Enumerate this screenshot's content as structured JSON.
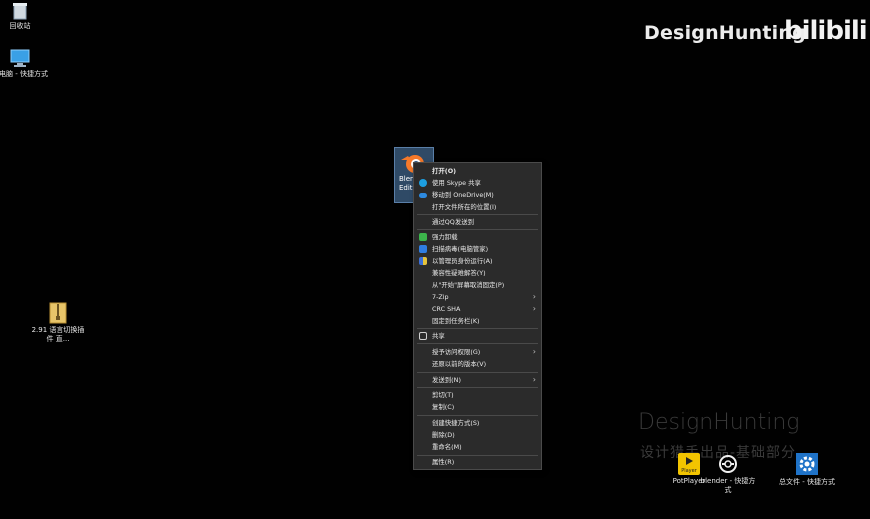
{
  "brand": {
    "name": "DesignHunting",
    "platform": "bilibili"
  },
  "watermark": {
    "en": "DesignHunting",
    "zh": "设计猎手出品-基础部分"
  },
  "desktop": {
    "icons": [
      {
        "label": "回收站",
        "icon": "recycle-bin-icon"
      },
      {
        "label": "此电脑 - 快捷方式",
        "icon": "computer-icon"
      },
      {
        "label": "2.91 语言切换插件 直...",
        "icon": "zip-folder-icon"
      },
      {
        "label": "PotPlayer",
        "icon": "potplayer-icon",
        "badge": "Player"
      },
      {
        "label": "blender - 快捷方式",
        "icon": "blender-shortcut-icon"
      },
      {
        "label": "总文件 - 快捷方式",
        "icon": "gear-icon"
      }
    ],
    "selected_icon_label": "Blen Oct Edit"
  },
  "context_menu": {
    "items": [
      {
        "label": "打开(O)",
        "bold": true
      },
      {
        "label": "使用 Skype 共享",
        "icon": "skype-icon"
      },
      {
        "label": "移动到 OneDrive(M)",
        "icon": "onedrive-icon"
      },
      {
        "label": "打开文件所在的位置(I)"
      },
      {
        "sep": true
      },
      {
        "label": "通过QQ发送到"
      },
      {
        "sep": true
      },
      {
        "label": "强力卸载",
        "icon": "uninstall-icon"
      },
      {
        "label": "扫描病毒(电脑管家)",
        "icon": "shield-scan-icon"
      },
      {
        "label": "以管理员身份运行(A)",
        "icon": "admin-shield-icon"
      },
      {
        "label": "兼容性疑难解答(Y)"
      },
      {
        "label": "从\"开始\"屏幕取消固定(P)"
      },
      {
        "label": "7-Zip",
        "submenu": true
      },
      {
        "label": "CRC SHA",
        "submenu": true
      },
      {
        "label": "固定到任务栏(K)"
      },
      {
        "sep": true
      },
      {
        "label": "共享",
        "icon": "share-icon"
      },
      {
        "sep": true
      },
      {
        "label": "授予访问权限(G)",
        "submenu": true
      },
      {
        "label": "还原以前的版本(V)"
      },
      {
        "sep": true
      },
      {
        "label": "发送到(N)",
        "submenu": true
      },
      {
        "sep": true
      },
      {
        "label": "剪切(T)"
      },
      {
        "label": "复制(C)"
      },
      {
        "sep": true
      },
      {
        "label": "创建快捷方式(S)"
      },
      {
        "label": "删除(D)"
      },
      {
        "label": "重命名(M)"
      },
      {
        "sep": true
      },
      {
        "label": "属性(R)"
      }
    ]
  }
}
